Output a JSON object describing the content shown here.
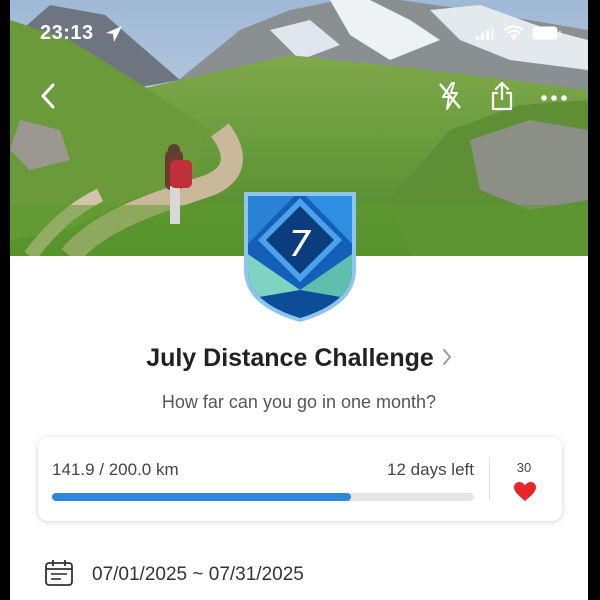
{
  "status_bar": {
    "time": "23:13"
  },
  "challenge": {
    "badge_number": "7",
    "title": "July Distance Challenge",
    "subtitle": "How far can you go in one month?"
  },
  "progress": {
    "distance_text": "141.9 / 200.0 km",
    "fraction": 0.7095,
    "days_left": "12 days left",
    "likes": "30"
  },
  "dates": {
    "range": "07/01/2025 ~ 07/31/2025"
  },
  "colors": {
    "accent": "#2f86da",
    "heart": "#e8252c",
    "badge_navy": "#0b3d7e",
    "badge_teal": "#7fd3c3"
  }
}
